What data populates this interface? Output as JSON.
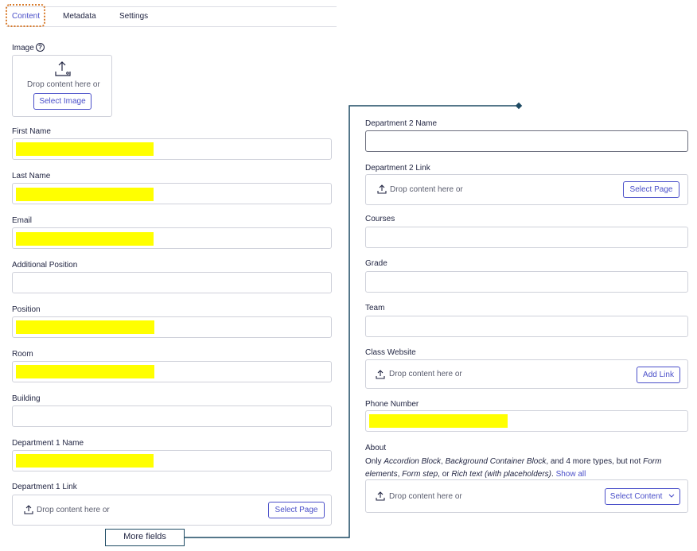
{
  "tabs": [
    {
      "label": "Content"
    },
    {
      "label": "Metadata"
    },
    {
      "label": "Settings"
    }
  ],
  "left": {
    "image": {
      "label": "Image",
      "help": "?",
      "drop_text": "Drop content here or",
      "button": "Select Image"
    },
    "first_name": {
      "label": "First Name",
      "value": ""
    },
    "last_name": {
      "label": "Last Name",
      "value": ""
    },
    "email": {
      "label": "Email",
      "value": ""
    },
    "additional_position": {
      "label": "Additional Position",
      "value": ""
    },
    "position": {
      "label": "Position",
      "value": ""
    },
    "room": {
      "label": "Room",
      "value": ""
    },
    "building": {
      "label": "Building",
      "value": ""
    },
    "department1_name": {
      "label": "Department 1 Name",
      "value": ""
    },
    "department1_link": {
      "label": "Department 1 Link",
      "drop_text": "Drop content here or",
      "button": "Select Page"
    }
  },
  "right": {
    "department2_name": {
      "label": "Department 2 Name",
      "value": ""
    },
    "department2_link": {
      "label": "Department 2 Link",
      "drop_text": "Drop content here or",
      "button": "Select Page"
    },
    "courses": {
      "label": "Courses",
      "value": ""
    },
    "grade": {
      "label": "Grade",
      "value": ""
    },
    "team": {
      "label": "Team",
      "value": ""
    },
    "class_website": {
      "label": "Class Website",
      "drop_text": "Drop content here or",
      "button": "Add Link"
    },
    "phone_number": {
      "label": "Phone Number",
      "value": ""
    },
    "about": {
      "label": "About",
      "desc_1": "Only ",
      "desc_2": "Accordion Block",
      "desc_3": ", ",
      "desc_4": "Background Container Block",
      "desc_5": ", and 4 more types, but not ",
      "desc_6": "Form elements",
      "desc_7": ", ",
      "desc_8": "Form step",
      "desc_9": ", or ",
      "desc_10": "Rich text (with placeholders)",
      "desc_11": ". ",
      "show_all": "Show all",
      "drop_text": "Drop content here or",
      "button": "Select Content"
    }
  },
  "callout": {
    "label": "More fields"
  },
  "colors": {
    "redaction": "#ffff00",
    "accent": "#4a4fc9",
    "highlight": "#d87a2a",
    "connector": "#1d4a63"
  }
}
